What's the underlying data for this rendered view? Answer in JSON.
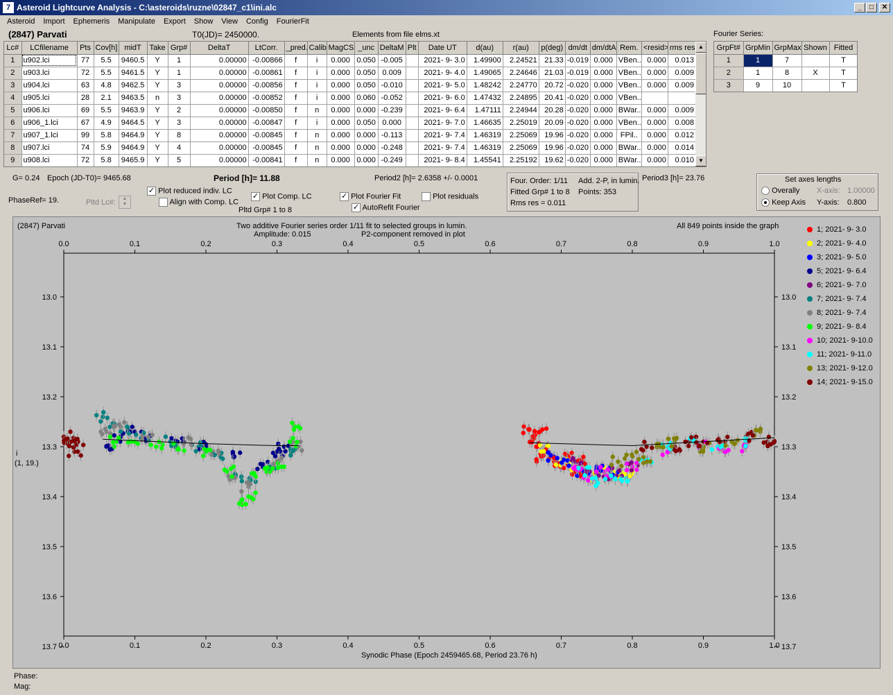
{
  "window": {
    "title": "Asteroid Lightcurve Analysis - C:\\asteroids\\ruzne\\02847_c1\\ini.alc",
    "icon": "app-icon"
  },
  "menu": [
    "Asteroid",
    "Import",
    "Ephemeris",
    "Manipulate",
    "Export",
    "Show",
    "View",
    "Config",
    "FourierFit"
  ],
  "header": {
    "asteroid": "(2847) Parvati",
    "t0": "T0(JD)= 2450000.",
    "elements": "Elements from file elms.xt",
    "fourier_label": "Fourier Series:"
  },
  "lc_table": {
    "columns": [
      "Lc#",
      "LCfilename",
      "Pts",
      "Cov[h]",
      "midT",
      "Take",
      "Grp#",
      "DeltaT",
      "LtCorr.",
      "_pred.",
      "Calib.",
      "MagCS",
      "_unc",
      "DeltaM",
      "Plt",
      "Date UT",
      "d(au)",
      "r(au)",
      "p(deg)",
      "dm/dt",
      "dm/dtA",
      "Rem.",
      "<resid>",
      "rms res"
    ],
    "rows": [
      [
        "1",
        "u902.lci",
        "77",
        "5.5",
        "9460.5",
        "Y",
        "1",
        "0.00000",
        "-0.00866",
        "f",
        "i",
        "0.000",
        "0.050",
        "-0.005",
        "",
        "2021- 9- 3.0",
        "1.49900",
        "2.24521",
        "21.33",
        "-0.019",
        "0.000",
        "VBen..",
        "0.000",
        "0.013"
      ],
      [
        "2",
        "u903.lci",
        "72",
        "5.5",
        "9461.5",
        "Y",
        "1",
        "0.00000",
        "-0.00861",
        "f",
        "i",
        "0.000",
        "0.050",
        "0.009",
        "",
        "2021- 9- 4.0",
        "1.49065",
        "2.24646",
        "21.03",
        "-0.019",
        "0.000",
        "VBen..",
        "0.000",
        "0.009"
      ],
      [
        "3",
        "u904.lci",
        "63",
        "4.8",
        "9462.5",
        "Y",
        "3",
        "0.00000",
        "-0.00856",
        "f",
        "i",
        "0.000",
        "0.050",
        "-0.010",
        "",
        "2021- 9- 5.0",
        "1.48242",
        "2.24770",
        "20.72",
        "-0.020",
        "0.000",
        "VBen..",
        "0.000",
        "0.009"
      ],
      [
        "4",
        "u905.lci",
        "28",
        "2.1",
        "9463.5",
        "n",
        "3",
        "0.00000",
        "-0.00852",
        "f",
        "i",
        "0.000",
        "0.060",
        "-0.052",
        "",
        "2021- 9- 6.0",
        "1.47432",
        "2.24895",
        "20.41",
        "-0.020",
        "0.000",
        "VBen..",
        "",
        ""
      ],
      [
        "5",
        "u906.lci",
        "69",
        "5.5",
        "9463.9",
        "Y",
        "2",
        "0.00000",
        "-0.00850",
        "f",
        "n",
        "0.000",
        "0.000",
        "-0.239",
        "",
        "2021- 9- 6.4",
        "1.47111",
        "2.24944",
        "20.28",
        "-0.020",
        "0.000",
        "BWar..",
        "0.000",
        "0.009"
      ],
      [
        "6",
        "u906_1.lci",
        "67",
        "4.9",
        "9464.5",
        "Y",
        "3",
        "0.00000",
        "-0.00847",
        "f",
        "i",
        "0.000",
        "0.050",
        "0.000",
        "",
        "2021- 9- 7.0",
        "1.46635",
        "2.25019",
        "20.09",
        "-0.020",
        "0.000",
        "VBen..",
        "0.000",
        "0.008"
      ],
      [
        "7",
        "u907_1.lci",
        "99",
        "5.8",
        "9464.9",
        "Y",
        "8",
        "0.00000",
        "-0.00845",
        "f",
        "n",
        "0.000",
        "0.000",
        "-0.113",
        "",
        "2021- 9- 7.4",
        "1.46319",
        "2.25069",
        "19.96",
        "-0.020",
        "0.000",
        "FPil..",
        "0.000",
        "0.012"
      ],
      [
        "8",
        "u907.lci",
        "74",
        "5.9",
        "9464.9",
        "Y",
        "4",
        "0.00000",
        "-0.00845",
        "f",
        "n",
        "0.000",
        "0.000",
        "-0.248",
        "",
        "2021- 9- 7.4",
        "1.46319",
        "2.25069",
        "19.96",
        "-0.020",
        "0.000",
        "BWar..",
        "0.000",
        "0.014"
      ],
      [
        "9",
        "u908.lci",
        "72",
        "5.8",
        "9465.9",
        "Y",
        "5",
        "0.00000",
        "-0.00841",
        "f",
        "n",
        "0.000",
        "0.000",
        "-0.249",
        "",
        "2021- 9- 8.4",
        "1.45541",
        "2.25192",
        "19.62",
        "-0.020",
        "0.000",
        "BWar..",
        "0.000",
        "0.010"
      ]
    ]
  },
  "fourier_table": {
    "columns": [
      "GrpFt#",
      "GrpMin",
      "GrpMax",
      "Shown",
      "Fitted"
    ],
    "rows": [
      [
        "1",
        "1",
        "7",
        "",
        "T"
      ],
      [
        "2",
        "1",
        "8",
        "X",
        "T"
      ],
      [
        "3",
        "9",
        "10",
        "",
        "T"
      ]
    ]
  },
  "info": {
    "g": "G= 0.24",
    "epoch": "Epoch (JD-T0)= 9465.68",
    "period": "Period [h]= 11.88",
    "period2": "Period2 [h]= 2.6358 +/- 0.0001",
    "period3": "Period3 [h]= 23.76",
    "phaseref": "PhaseRef= 19.",
    "pltd_lc": "Pltd Lc#:",
    "pltd_grp": "Pltd Grp#  1   to   8"
  },
  "checkboxes": [
    {
      "label": "Plot reduced indiv. LC",
      "checked": true
    },
    {
      "label": "Align with Comp. LC",
      "checked": false
    },
    {
      "label": "Plot Comp. LC",
      "checked": true
    },
    {
      "label": "Plot Fourier Fit",
      "checked": true
    },
    {
      "label": "AutoRefit Fourier",
      "checked": true
    },
    {
      "label": "Plot residuals",
      "checked": false
    }
  ],
  "fit_info": {
    "order": "Four. Order:  1/11",
    "add": "Add. 2-P, in lumin.",
    "fitted": "Fitted Grp# 1 to 8",
    "points": "Points: 353",
    "rms": "Rms res      = 0.011"
  },
  "axes_box": {
    "title": "Set axes lengths",
    "overally": "Overally",
    "keep": "Keep Axis",
    "xaxis": "X-axis:",
    "xval": "1.00000",
    "yaxis": "Y-axis:",
    "yval": "0.800",
    "selected": "keep"
  },
  "graph": {
    "name": "(2847) Parvati",
    "line1": "Two additive Fourier series order 1/11 fit to selected groups in lumin.",
    "line2a": "Amplitude: 0.015",
    "line2b": "P2-component removed in plot",
    "inside": "All 849 points inside the graph",
    "ylabel1": "i",
    "ylabel2": "(1, 19.)",
    "xlabel": "Synodic Phase (Epoch 2459465.68, Period 23.76 h)"
  },
  "status": {
    "phase": "Phase:",
    "mag": "Mag:"
  },
  "chart_data": {
    "type": "scatter",
    "xlim": [
      0,
      1
    ],
    "ylim": [
      13.7,
      12.9
    ],
    "x_ticks": [
      "0.0",
      "0.1",
      "0.2",
      "0.3",
      "0.4",
      "0.5",
      "0.6",
      "0.7",
      "0.8",
      "0.9",
      "1.0"
    ],
    "y_ticks": [
      "13.0",
      "13.1",
      "13.2",
      "13.3",
      "13.4",
      "13.5",
      "13.6",
      "13.7"
    ],
    "legend": [
      {
        "label": "1; 2021- 9- 3.0",
        "color": "#ff0000"
      },
      {
        "label": "2; 2021- 9- 4.0",
        "color": "#ffff00"
      },
      {
        "label": "3; 2021- 9- 5.0",
        "color": "#0000ff"
      },
      {
        "label": "5; 2021- 9- 6.4",
        "color": "#00008b"
      },
      {
        "label": "6; 2021- 9- 7.0",
        "color": "#800080"
      },
      {
        "label": "7; 2021- 9- 7.4",
        "color": "#008080"
      },
      {
        "label": "8; 2021- 9- 7.4",
        "color": "#808080"
      },
      {
        "label": "9; 2021- 9- 8.4",
        "color": "#00ff00"
      },
      {
        "label": "10; 2021- 9-10.0",
        "color": "#ff00ff"
      },
      {
        "label": "11; 2021- 9-11.0",
        "color": "#00ffff"
      },
      {
        "label": "13; 2021- 9-12.0",
        "color": "#808000"
      },
      {
        "label": "14; 2021- 9-15.0",
        "color": "#800000"
      }
    ],
    "series": [
      {
        "name": "1; 2021- 9- 3.0",
        "values": [
          [
            0.655,
            13.265
          ],
          [
            0.66,
            13.285
          ],
          [
            0.665,
            13.3
          ],
          [
            0.67,
            13.27
          ],
          [
            0.672,
            13.32
          ],
          [
            0.68,
            13.31
          ],
          [
            0.69,
            13.33
          ],
          [
            0.7,
            13.34
          ],
          [
            0.71,
            13.32
          ],
          [
            0.72,
            13.35
          ],
          [
            0.73,
            13.33
          ]
        ]
      },
      {
        "name": "2; 2021- 9- 4.0",
        "values": [
          [
            0.68,
            13.3
          ],
          [
            0.7,
            13.33
          ],
          [
            0.72,
            13.34
          ],
          [
            0.74,
            13.36
          ],
          [
            0.76,
            13.35
          ],
          [
            0.78,
            13.36
          ],
          [
            0.8,
            13.35
          ]
        ]
      },
      {
        "name": "3; 2021- 9- 5.0",
        "values": [
          [
            0.69,
            13.32
          ],
          [
            0.71,
            13.33
          ],
          [
            0.73,
            13.35
          ],
          [
            0.75,
            13.34
          ],
          [
            0.77,
            13.35
          ]
        ]
      },
      {
        "name": "5; 2021- 9- 6.4",
        "values": [
          [
            0.06,
            13.3
          ],
          [
            0.08,
            13.28
          ],
          [
            0.1,
            13.27
          ],
          [
            0.12,
            13.28
          ],
          [
            0.16,
            13.29
          ],
          [
            0.2,
            13.3
          ],
          [
            0.24,
            13.32
          ],
          [
            0.28,
            13.34
          ],
          [
            0.3,
            13.31
          ],
          [
            0.31,
            13.3
          ]
        ]
      },
      {
        "name": "6; 2021- 9- 7.0",
        "values": [
          [
            0.72,
            13.33
          ],
          [
            0.74,
            13.35
          ],
          [
            0.76,
            13.36
          ],
          [
            0.78,
            13.35
          ],
          [
            0.8,
            13.34
          ]
        ]
      },
      {
        "name": "7; 2021- 9- 7.4",
        "values": [
          [
            0.055,
            13.24
          ],
          [
            0.07,
            13.26
          ],
          [
            0.09,
            13.27
          ],
          [
            0.11,
            13.28
          ],
          [
            0.15,
            13.29
          ],
          [
            0.19,
            13.3
          ],
          [
            0.22,
            13.32
          ],
          [
            0.25,
            13.36
          ],
          [
            0.27,
            13.37
          ],
          [
            0.29,
            13.34
          ],
          [
            0.32,
            13.31
          ]
        ]
      },
      {
        "name": "8; 2021- 9- 7.4",
        "values": [
          [
            0.06,
            13.27
          ],
          [
            0.08,
            13.26
          ],
          [
            0.12,
            13.28
          ],
          [
            0.17,
            13.29
          ],
          [
            0.21,
            13.31
          ],
          [
            0.24,
            13.36
          ],
          [
            0.26,
            13.38
          ],
          [
            0.3,
            13.33
          ],
          [
            0.33,
            13.3
          ]
        ]
      },
      {
        "name": "9; 2021- 9- 8.4",
        "values": [
          [
            0.075,
            13.29
          ],
          [
            0.1,
            13.29
          ],
          [
            0.13,
            13.3
          ],
          [
            0.16,
            13.3
          ],
          [
            0.2,
            13.31
          ],
          [
            0.23,
            13.35
          ],
          [
            0.25,
            13.41
          ],
          [
            0.26,
            13.4
          ],
          [
            0.27,
            13.36
          ],
          [
            0.29,
            13.35
          ],
          [
            0.31,
            13.34
          ],
          [
            0.32,
            13.29
          ],
          [
            0.33,
            13.26
          ]
        ]
      },
      {
        "name": "10; 2021- 9-10.0",
        "values": [
          [
            0.72,
            13.34
          ],
          [
            0.74,
            13.36
          ],
          [
            0.76,
            13.35
          ],
          [
            0.8,
            13.34
          ],
          [
            0.85,
            13.31
          ],
          [
            0.9,
            13.3
          ],
          [
            0.93,
            13.31
          ],
          [
            0.96,
            13.3
          ]
        ]
      },
      {
        "name": "11; 2021- 9-11.0",
        "values": [
          [
            0.73,
            13.35
          ],
          [
            0.75,
            13.37
          ],
          [
            0.77,
            13.36
          ],
          [
            0.79,
            13.36
          ],
          [
            0.82,
            13.33
          ],
          [
            0.85,
            13.3
          ],
          [
            0.88,
            13.29
          ],
          [
            0.92,
            13.3
          ],
          [
            0.96,
            13.29
          ]
        ]
      },
      {
        "name": "13; 2021- 9-12.0",
        "values": [
          [
            0.78,
            13.33
          ],
          [
            0.8,
            13.32
          ],
          [
            0.82,
            13.33
          ],
          [
            0.84,
            13.3
          ],
          [
            0.86,
            13.29
          ],
          [
            0.9,
            13.3
          ],
          [
            0.94,
            13.29
          ],
          [
            0.98,
            13.27
          ]
        ]
      },
      {
        "name": "14; 2021- 9-15.0",
        "values": [
          [
            0.0,
            13.28
          ],
          [
            0.005,
            13.29
          ],
          [
            0.01,
            13.29
          ],
          [
            0.015,
            13.31
          ],
          [
            0.02,
            13.29
          ],
          [
            0.82,
            13.3
          ],
          [
            0.86,
            13.3
          ],
          [
            0.88,
            13.29
          ],
          [
            0.9,
            13.29
          ],
          [
            0.93,
            13.29
          ],
          [
            0.96,
            13.28
          ],
          [
            0.99,
            13.29
          ],
          [
            1.0,
            13.29
          ]
        ]
      }
    ],
    "fit_line": [
      [
        0.055,
        13.285
      ],
      [
        0.1,
        13.288
      ],
      [
        0.2,
        13.294
      ],
      [
        0.3,
        13.298
      ],
      [
        0.33,
        13.298
      ]
    ],
    "fit_line2": [
      [
        0.655,
        13.292
      ],
      [
        0.7,
        13.294
      ],
      [
        0.8,
        13.298
      ],
      [
        0.9,
        13.29
      ],
      [
        1.0,
        13.282
      ]
    ]
  }
}
